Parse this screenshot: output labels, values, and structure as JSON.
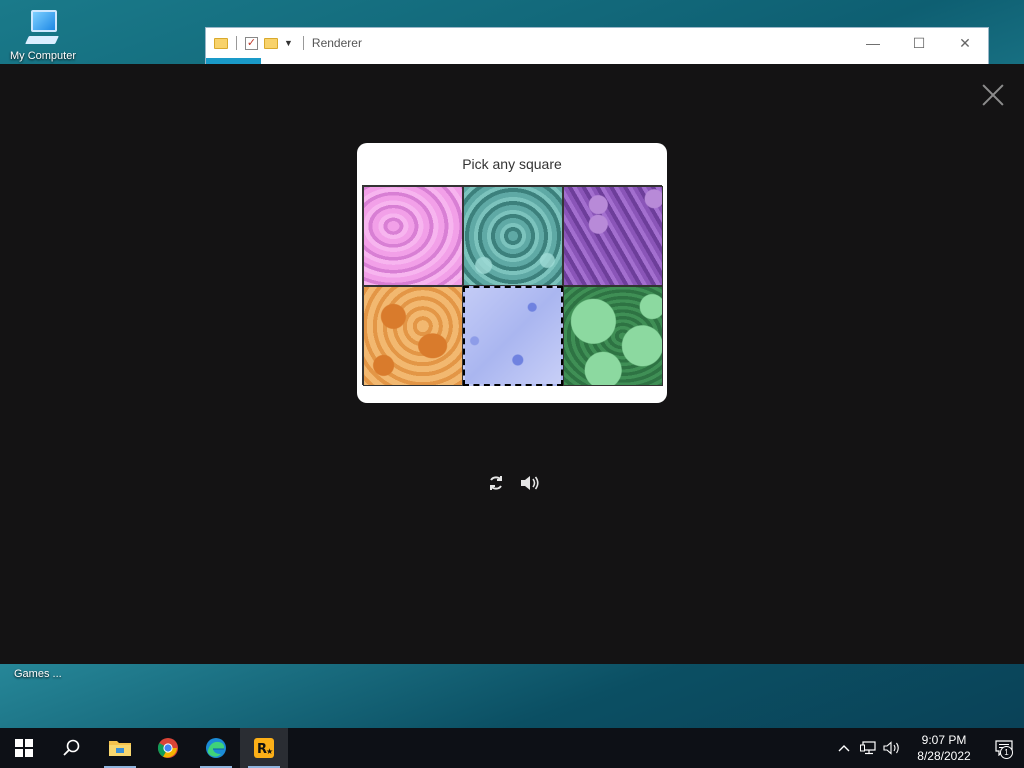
{
  "desktop": {
    "computer_icon_label": "My Computer",
    "games_label": "Games ..."
  },
  "explorer": {
    "title": "Renderer",
    "minimize": "—",
    "maximize": "☐",
    "close": "✕"
  },
  "captcha": {
    "prompt": "Pick any square",
    "tiles": [
      {
        "name": "pink",
        "selected": false
      },
      {
        "name": "teal",
        "selected": false
      },
      {
        "name": "purple",
        "selected": false
      },
      {
        "name": "orange",
        "selected": false
      },
      {
        "name": "blue",
        "selected": true
      },
      {
        "name": "green",
        "selected": false
      }
    ],
    "tools": [
      "refresh-icon",
      "audio-icon"
    ]
  },
  "taskbar": {
    "apps": [
      "start-icon",
      "search-icon",
      "file-explorer-icon",
      "chrome-icon",
      "edge-icon",
      "rockstar-icon"
    ],
    "time": "9:07 PM",
    "date": "8/28/2022",
    "notification_count": "1"
  }
}
